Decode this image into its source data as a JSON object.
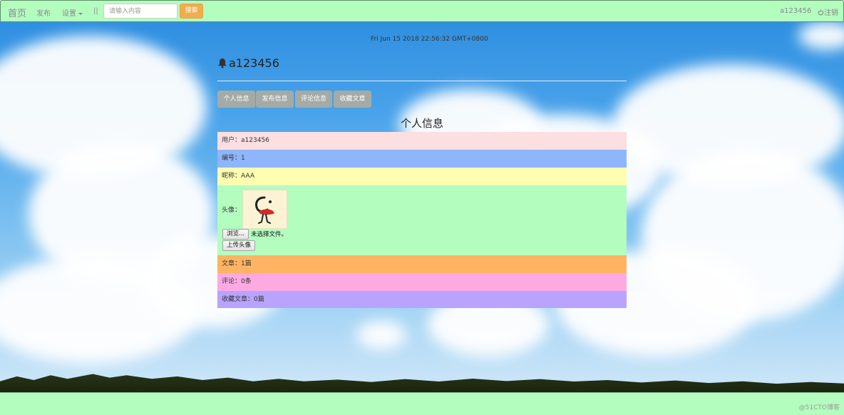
{
  "navbar": {
    "home": "首页",
    "publish": "发布",
    "settings": "设置",
    "separator": "||",
    "search_placeholder": "请输入内容",
    "search_button": "搜索",
    "username": "a123456",
    "logout": "注销"
  },
  "clock": "Fri Jun 15 2018 22:56:32 GMT+0800",
  "heading": {
    "username": "a123456",
    "icon": "bell-icon"
  },
  "tabs": [
    {
      "label": "个人信息"
    },
    {
      "label": "发布信息"
    },
    {
      "label": "评论信息"
    },
    {
      "label": "收藏文章"
    }
  ],
  "section_title": "个人信息",
  "profile": {
    "user": "用户：a123456",
    "id": "编号：1",
    "nickname": "昵称：AAA",
    "avatar_label": "头像：",
    "browse_button": "浏览...",
    "file_status": "未选择文件。",
    "upload_button": "上传头像",
    "articles": "文章：1篇",
    "comments": "评论：0条",
    "favorites": "收藏文章：0篇"
  },
  "footer": {
    "watermark": "@51CTO博客"
  },
  "colors": {
    "navbar_bg": "#b3fdbf",
    "search_button": "#f0ad4e",
    "tab_bg": "#a4aba6",
    "row_user": "#fcdfe0",
    "row_id": "#8fb6fb",
    "row_nickname": "#fefdb0",
    "row_avatar": "#b3fdbf",
    "row_articles": "#feb463",
    "row_comments": "#fdaae3",
    "row_favorites": "#b8a4fe"
  }
}
